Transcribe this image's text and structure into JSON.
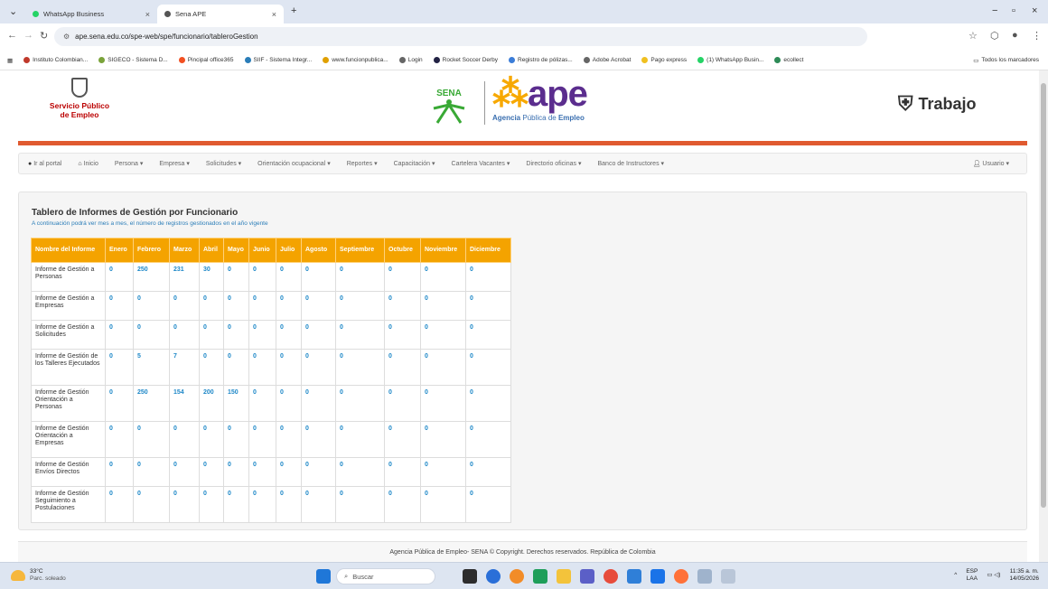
{
  "browser": {
    "tabs": [
      {
        "label": "WhatsApp Business"
      },
      {
        "label": "Sena APE"
      }
    ],
    "url": "ape.sena.edu.co/spe-web/spe/funcionario/tableroGestion",
    "bookmarks": [
      "Instituto Colombian...",
      "SIGECO - Sistema D...",
      "Pincipal office365",
      "SIIF - Sistema Integr...",
      "www.funcionpublica...",
      "Login",
      "Rocket Soccer Derby",
      "Registro de pólizas...",
      "Adobe Acrobat",
      "Pago express",
      "(1) WhatsApp Busin...",
      "ecollect"
    ],
    "all_bookmarks": "Todos los marcadores"
  },
  "header": {
    "spe_line1": "Servicio Público",
    "spe_line2": "de Empleo",
    "sena": "SENA",
    "ape": "ape",
    "ape_sub_a": "Agencia",
    "ape_sub_b": "Pública de",
    "ape_sub_c": "Empleo",
    "trabajo": "Trabajo"
  },
  "menu": {
    "items": [
      "Ir al portal",
      "Inicio",
      "Persona ▾",
      "Empresa ▾",
      "Solicitudes ▾",
      "Orientación ocupacional ▾",
      "Reportes ▾",
      "Capacitación ▾",
      "Cartelera Vacantes ▾",
      "Directorio oficinas ▾",
      "Banco de Instructores ▾"
    ],
    "user": "Usuario ▾"
  },
  "panel": {
    "title": "Tablero de Informes de Gestión por Funcionario",
    "subtitle": "A continuación podrá ver mes a mes, el número de registros gestionados en el año vigente",
    "columns": [
      "Nombre del Informe",
      "Enero",
      "Febrero",
      "Marzo",
      "Abril",
      "Mayo",
      "Junio",
      "Julio",
      "Agosto",
      "Septiembre",
      "Octubre",
      "Noviembre",
      "Diciembre"
    ],
    "rows": [
      {
        "name": "Informe de Gestión a Personas",
        "values": [
          "0",
          "250",
          "231",
          "30",
          "0",
          "0",
          "0",
          "0",
          "0",
          "0",
          "0",
          "0"
        ]
      },
      {
        "name": "Informe de Gestión a Empresas",
        "values": [
          "0",
          "0",
          "0",
          "0",
          "0",
          "0",
          "0",
          "0",
          "0",
          "0",
          "0",
          "0"
        ]
      },
      {
        "name": "Informe de Gestión a Solicitudes",
        "values": [
          "0",
          "0",
          "0",
          "0",
          "0",
          "0",
          "0",
          "0",
          "0",
          "0",
          "0",
          "0"
        ]
      },
      {
        "name": "Informe de Gestión de los Talleres Ejecutados",
        "values": [
          "0",
          "5",
          "7",
          "0",
          "0",
          "0",
          "0",
          "0",
          "0",
          "0",
          "0",
          "0"
        ]
      },
      {
        "name": "Informe de Gestión Orientación a Personas",
        "values": [
          "0",
          "250",
          "154",
          "200",
          "150",
          "0",
          "0",
          "0",
          "0",
          "0",
          "0",
          "0"
        ]
      },
      {
        "name": "Informe de Gestión Orientación a Empresas",
        "values": [
          "0",
          "0",
          "0",
          "0",
          "0",
          "0",
          "0",
          "0",
          "0",
          "0",
          "0",
          "0"
        ]
      },
      {
        "name": "Informe de Gestión Envíos Directos",
        "values": [
          "0",
          "0",
          "0",
          "0",
          "0",
          "0",
          "0",
          "0",
          "0",
          "0",
          "0",
          "0"
        ]
      },
      {
        "name": "Informe de Gestión Seguimiento a Postulaciones",
        "values": [
          "0",
          "0",
          "0",
          "0",
          "0",
          "0",
          "0",
          "0",
          "0",
          "0",
          "0",
          "0"
        ]
      }
    ]
  },
  "footer": {
    "text": "Agencia Pública de Empleo- SENA © Copyright. Derechos reservados. República de Colombia"
  },
  "taskbar": {
    "temp": "33°C",
    "weather": "Parc. soleado",
    "search_placeholder": "Buscar",
    "lang1": "ESP",
    "lang2": "LAA",
    "time": "11:35 a. m.",
    "date": "14/05/2026"
  }
}
